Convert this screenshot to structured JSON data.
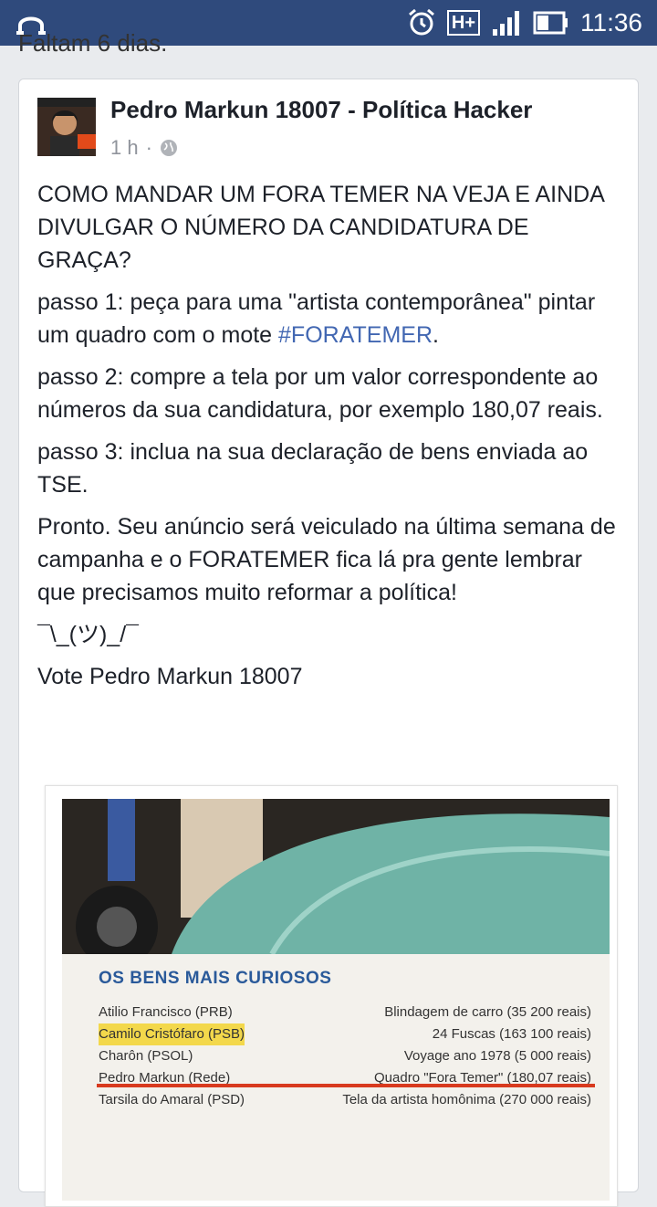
{
  "statusbar": {
    "time": "11:36",
    "network": "H+"
  },
  "previous_post": {
    "text": "Faltam 6 dias."
  },
  "post": {
    "author": "Pedro Markun 18007 - Política Hacker",
    "time": "1 h",
    "paragraphs": [
      "COMO MANDAR UM FORA TEMER NA VEJA E AINDA DIVULGAR O NÚMERO DA CANDIDATURA DE GRAÇA?",
      "passo 2: compre a tela por um valor correspondente ao números da sua candidatura, por exemplo 180,07 reais.",
      "passo 3: inclua na sua declaração de bens enviada ao TSE.",
      "Pronto. Seu anúncio será veiculado na última semana de campanha e o FORATEMER fica lá pra gente lembrar que precisamos muito reformar a política!",
      "¯\\_(ツ)_/¯",
      "Vote Pedro Markun 18007"
    ],
    "step1_prefix": "passo 1: peça para uma \"artista contemporânea\" pintar um quadro com o mote ",
    "hashtag": "#FORATEMER",
    "step1_suffix": "."
  },
  "image": {
    "heading": "OS BENS MAIS CURIOSOS",
    "rows": [
      {
        "name": "Atilio Francisco (PRB)",
        "item": "Blindagem de carro (35 200 reais)"
      },
      {
        "name": "Camilo Cristófaro (PSB)",
        "item": "24 Fuscas (163 100 reais)"
      },
      {
        "name": "Charôn (PSOL)",
        "item": "Voyage ano 1978 (5 000 reais)"
      },
      {
        "name": "Pedro Markun (Rede)",
        "item": "Quadro \"Fora Temer\" (180,07 reais)"
      },
      {
        "name": "Tarsila do Amaral (PSD)",
        "item": "Tela da artista homônima (270 000 reais)"
      }
    ]
  }
}
